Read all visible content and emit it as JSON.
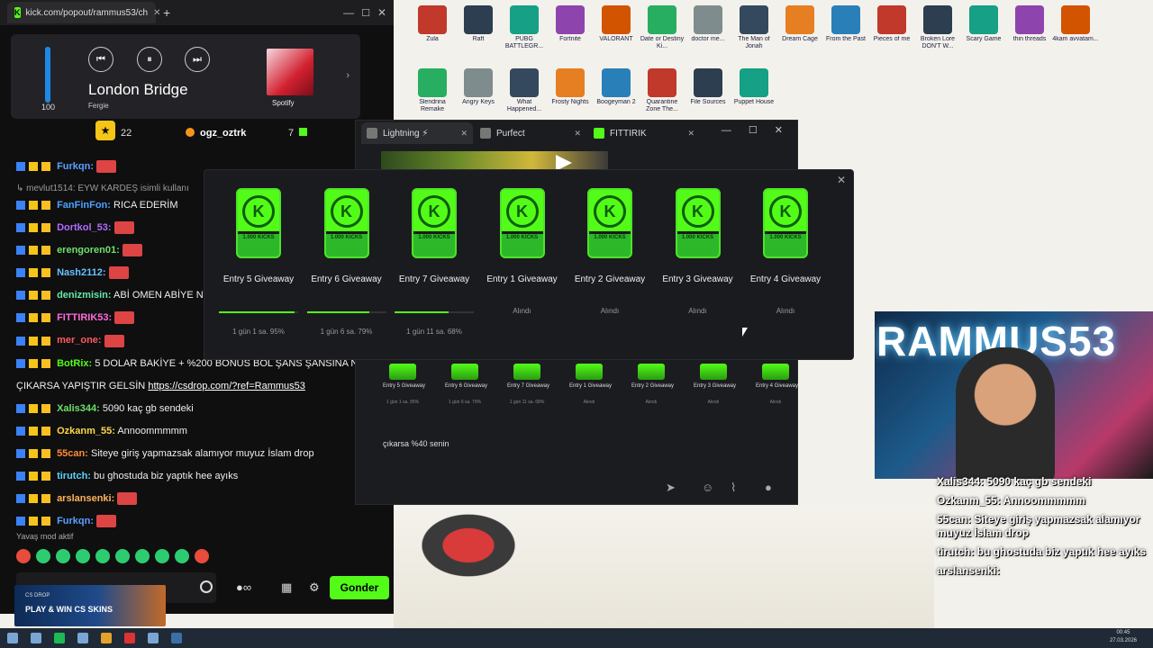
{
  "browser": {
    "tab_title": "kick.com/popout/rammus53/ch",
    "tab_favicon": "K"
  },
  "media_player": {
    "volume": 100,
    "track_title": "London Bridge",
    "artist": "Fergie",
    "source": "Spotify",
    "accent_color": "#1e88e5"
  },
  "leaderboard": {
    "rank": "22",
    "username": "ogz_oztrk",
    "count": "7"
  },
  "chat": {
    "messages": [
      {
        "user": "Furkqn:",
        "text": "",
        "color": "#5aa0ff"
      },
      {
        "system": true,
        "text": "↳ mevlut1514: EYW KARDEŞ isimli kullanı"
      },
      {
        "user": "FanFinFon:",
        "text": "RICA EDERİM",
        "color": "#4aa3ff"
      },
      {
        "user": "Dortkol_53:",
        "text": "",
        "color": "#b06cff"
      },
      {
        "user": "erengoren01:",
        "text": "",
        "color": "#6ee06a"
      },
      {
        "user": "Nash2112:",
        "text": "",
        "color": "#66c2ff"
      },
      {
        "user": "denizmisin:",
        "text": "ABİ OMEN ABİYE NOLDU",
        "color": "#67e8a9"
      },
      {
        "user": "FITTIRIK53:",
        "text": "",
        "color": "#ff6bd6"
      },
      {
        "user": "mer_one:",
        "text": "",
        "color": "#ff5a5a"
      },
      {
        "user": "BotRix:",
        "text": "5 DOLAR BAKİYE + %200 BONUS BOL ŞANS ŞANSINA N",
        "color": "#53fc18"
      },
      {
        "user": "",
        "text": "ÇIKARSA YAPIŞTIR GELSİN",
        "link": "https://csdrop.com/?ref=Rammus53"
      },
      {
        "user": "Xalis344:",
        "text": "5090 kaç gb sendeki",
        "color": "#6ee06a"
      },
      {
        "user": "Ozkanm_55:",
        "text": "Annoommmmm",
        "color": "#ffd84a"
      },
      {
        "user": "55can:",
        "text": "Siteye giriş yapmazsak alamıyor muyuz İslam drop",
        "color": "#ff8a3a"
      },
      {
        "user": "tirutch:",
        "text": "bu ghostuda biz yaptık hee ayıks",
        "color": "#5ad1ff"
      },
      {
        "user": "arslansenki:",
        "text": "",
        "color": "#ffb35a"
      },
      {
        "user": "Furkqn:",
        "text": "",
        "color": "#5aa0ff"
      }
    ],
    "slow_mode": "Yavaş mod aktif",
    "send_label": "Gonder",
    "promo_brand": "CS DROP",
    "promo_text": "PLAY & WIN CS SKINS"
  },
  "browser2": {
    "tabs": [
      {
        "label": "Lightning ⚡"
      },
      {
        "label": "Purfect"
      },
      {
        "label": "FITTIRIK"
      }
    ],
    "chat_line": "çıkarsa %40 senin"
  },
  "giveaways": [
    {
      "title": "Entry 5 Giveaway",
      "status": "1 gün 1 sa. 95%",
      "progress": 0.95,
      "claimed": false
    },
    {
      "title": "Entry 6 Giveaway",
      "status": "1 gün 6 sa. 79%",
      "progress": 0.79,
      "claimed": false
    },
    {
      "title": "Entry 7 Giveaway",
      "status": "1 gün 11 sa. 68%",
      "progress": 0.68,
      "claimed": false
    },
    {
      "title": "Entry 1 Giveaway",
      "status": "Alındı",
      "progress": 0,
      "claimed": true
    },
    {
      "title": "Entry 2 Giveaway",
      "status": "Alındı",
      "progress": 0,
      "claimed": true
    },
    {
      "title": "Entry 3 Giveaway",
      "status": "Alındı",
      "progress": 0,
      "claimed": true
    },
    {
      "title": "Entry 4 Giveaway",
      "status": "Alındı",
      "progress": 0,
      "claimed": true
    }
  ],
  "giveaway_badge_text": "1.000 KICKS",
  "small_giveaways": [
    {
      "title": "Entry 5 Giveaway",
      "status": "1 gün 1 sa. 95%"
    },
    {
      "title": "Entry 6 Giveaway",
      "status": "1 gün 6 sa. 79%"
    },
    {
      "title": "Entry 7 Giveaway",
      "status": "1 gün 11 sa. 68%"
    },
    {
      "title": "Entry 1 Giveaway",
      "status": "Alındı"
    },
    {
      "title": "Entry 2 Giveaway",
      "status": "Alındı"
    },
    {
      "title": "Entry 3 Giveaway",
      "status": "Alındı"
    },
    {
      "title": "Entry 4 Giveaway",
      "status": "Alındı"
    }
  ],
  "webcam_sign": "RAMMUS53",
  "overlay_chat": [
    {
      "user": "Xalis344:",
      "text": "5090 kaç gb sendeki"
    },
    {
      "user": "Ozkanm_55:",
      "text": "Annoommmmm"
    },
    {
      "user": "55can:",
      "text": "Siteye giriş yapmazsak alamıyor muyuz İslam drop"
    },
    {
      "user": "tirutch:",
      "text": "bu ghostuda biz yaptık hee ayıks"
    },
    {
      "user": "arslansenki:",
      "text": ""
    }
  ],
  "desktop_icons": [
    {
      "label": "Zula"
    },
    {
      "label": "Raft"
    },
    {
      "label": "PUBG BATTLEGR..."
    },
    {
      "label": "Fortnite"
    },
    {
      "label": "VALORANT"
    },
    {
      "label": "Date or Destiny Ki..."
    },
    {
      "label": "doctor me..."
    },
    {
      "label": "The Man of Jonah"
    },
    {
      "label": "Dream Cage"
    },
    {
      "label": "From the Past"
    },
    {
      "label": "Pieces of me"
    },
    {
      "label": "Broken Lore DON'T W..."
    },
    {
      "label": "Scary Game"
    },
    {
      "label": "thin threads"
    },
    {
      "label": "4kam avvatam..."
    },
    {
      "label": "Slendrina Remake"
    },
    {
      "label": "Angry Keys"
    },
    {
      "label": "What Happened..."
    },
    {
      "label": "Frosty Nights"
    },
    {
      "label": "Boogeyman 2"
    },
    {
      "label": "Quarantine Zone The..."
    },
    {
      "label": "File Sources"
    },
    {
      "label": "Puppet House"
    }
  ],
  "clock": {
    "time": "00:45",
    "date": "27.03.2026"
  }
}
